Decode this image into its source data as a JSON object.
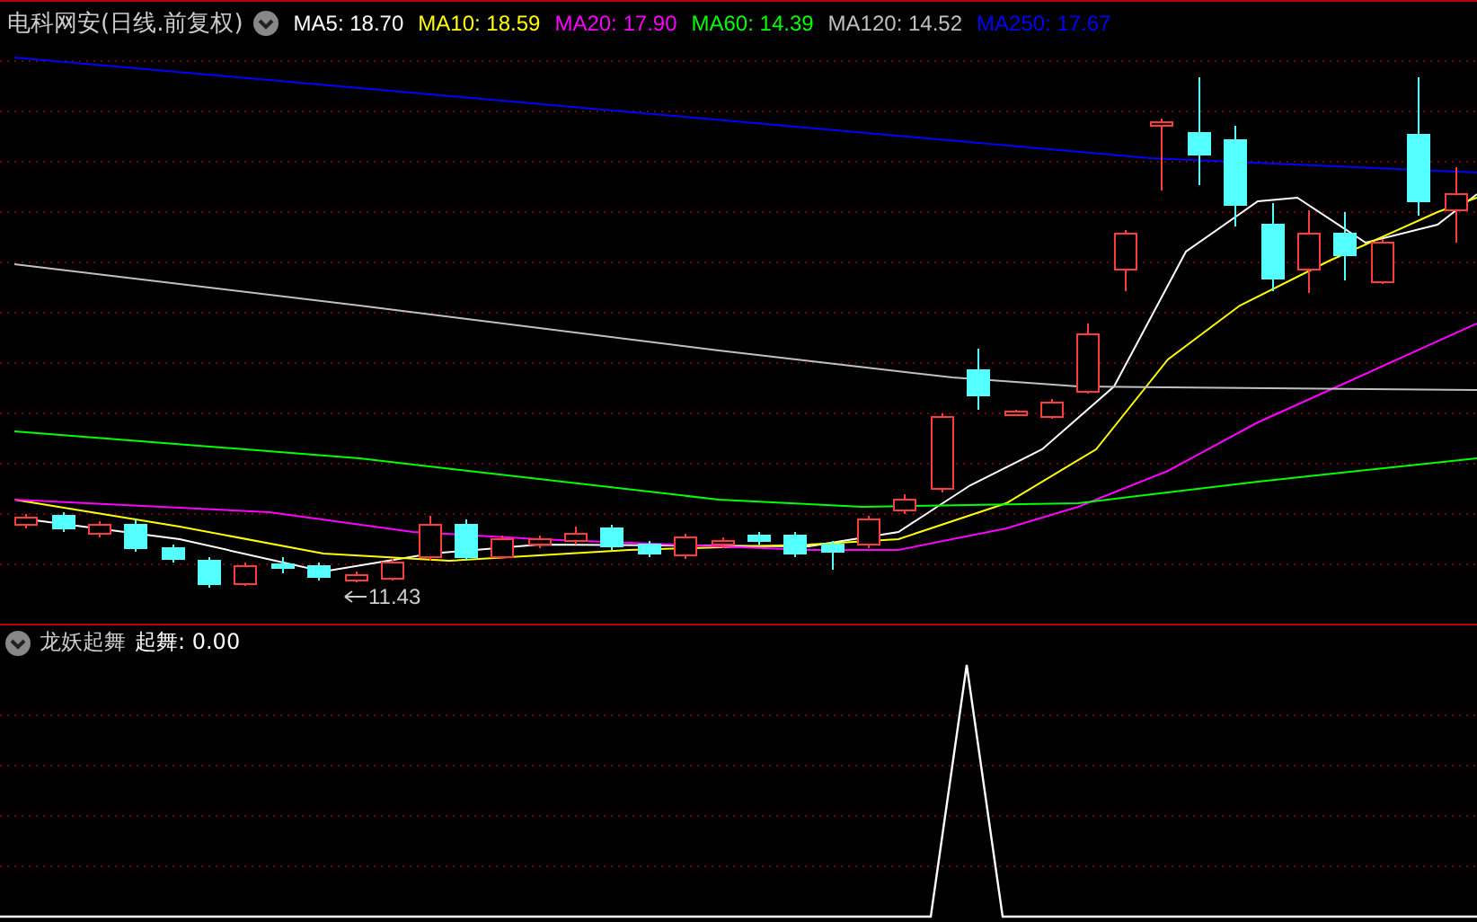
{
  "header": {
    "title": "电科网安(日线.前复权)",
    "averages": [
      {
        "label": "MA5: 18.70",
        "color": "#ffffff"
      },
      {
        "label": "MA10: 18.59",
        "color": "#ffff00"
      },
      {
        "label": "MA20: 17.90",
        "color": "#ff00ff"
      },
      {
        "label": "MA60: 14.39",
        "color": "#00ff00"
      },
      {
        "label": "MA120: 14.52",
        "color": "#c0c0c0"
      },
      {
        "label": "MA250: 17.67",
        "color": "#0000ff"
      }
    ]
  },
  "price_chart": {
    "low_label": "11.43"
  },
  "indicator": {
    "name": "龙妖起舞",
    "reading": "起舞: 0.00"
  }
}
